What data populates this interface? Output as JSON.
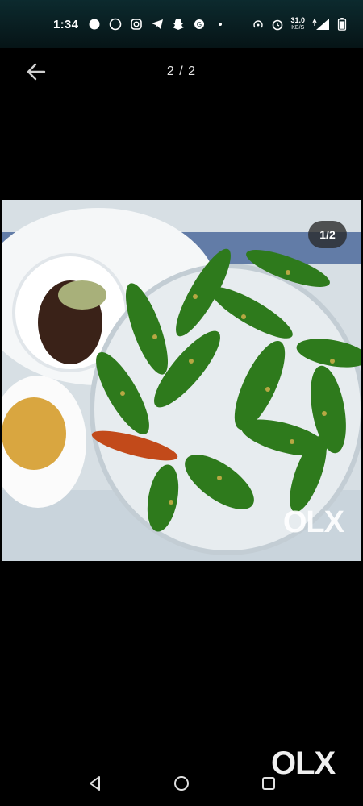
{
  "status_bar": {
    "time": "1:34",
    "network_speed": "31.0",
    "network_unit": "KB/S",
    "network_type": "4G"
  },
  "viewer": {
    "page_counter": "2 / 2",
    "photo_badge": "1/2",
    "photo_watermark": "OLX",
    "corner_watermark": "OLX"
  },
  "icons": {
    "back": "back-arrow-icon",
    "nav_back": "triangle-back-icon",
    "nav_home": "circle-home-icon",
    "nav_recents": "square-recents-icon"
  },
  "colors": {
    "background": "#000000",
    "status_bar": "#0c2a2e"
  }
}
